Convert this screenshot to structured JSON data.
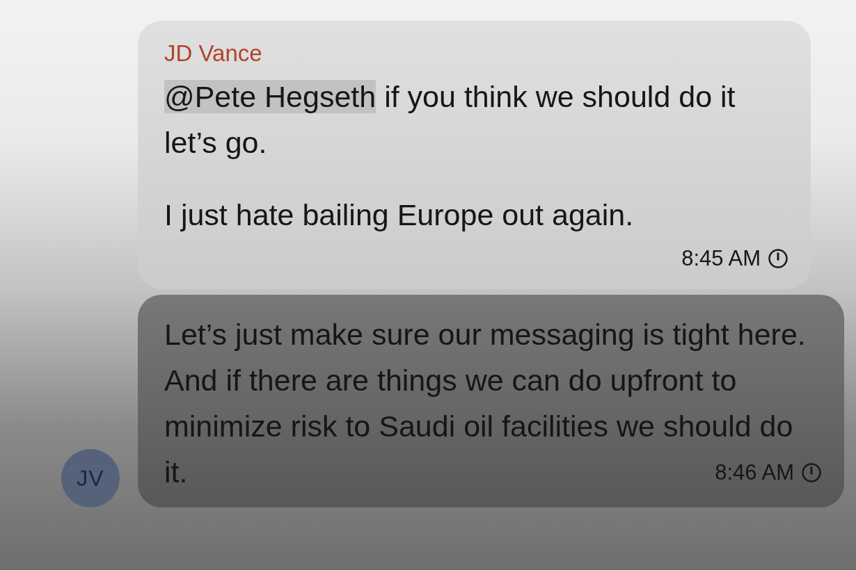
{
  "messages": [
    {
      "sender": "JD Vance",
      "mention": "@Pete Hegseth",
      "paragraphs": [
        "if you think we should do it let’s go.",
        "I just hate bailing Europe out again."
      ],
      "time": "8:45 AM"
    },
    {
      "paragraphs": [
        "Let’s just make sure our messaging is tight here. And if there are things we can do upfront to minimize risk to Saudi oil facilities we should do it."
      ],
      "time": "8:46 AM",
      "avatar": "JV"
    }
  ]
}
